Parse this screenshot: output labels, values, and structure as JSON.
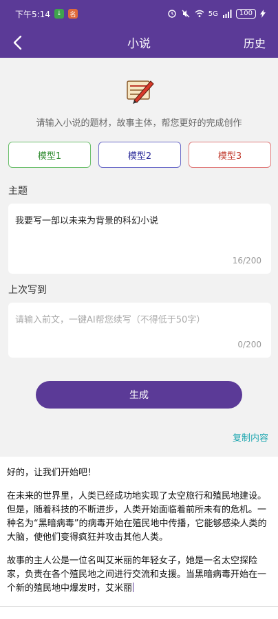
{
  "status_bar": {
    "time": "下午5:14",
    "badge_1": "↓",
    "badge_2": "名",
    "network": "5G",
    "battery": "100"
  },
  "header": {
    "title": "小说",
    "history_label": "历史"
  },
  "intro": "请输入小说的题材，故事主体，帮您更好的完成创作",
  "models": [
    {
      "label": "模型1",
      "color": "#2e8b2e"
    },
    {
      "label": "模型2",
      "color": "#2b2b9a"
    },
    {
      "label": "模型3",
      "color": "#c0392b"
    }
  ],
  "topic": {
    "label": "主题",
    "value": "我要写一部以未来为背景的科幻小说",
    "counter": "16/200"
  },
  "previous": {
    "label": "上次写到",
    "placeholder": "请输入前文，一键AI帮您续写（不得低于50字）",
    "counter": "0/200"
  },
  "generate_label": "生成",
  "copy_label": "复制内容",
  "output": {
    "paragraphs": [
      "好的，让我们开始吧！",
      "在未来的世界里，人类已经成功地实现了太空旅行和殖民地建设。但是，随着科技的不断进步，人类开始面临着前所未有的危机。一种名为“黑暗病毒”的病毒开始在殖民地中传播，它能够感染人类的大脑，使他们变得疯狂并攻击其他人类。",
      "故事的主人公是一位名叫艾米丽的年轻女子，她是一名太空探险家，负责在各个殖民地之间进行交流和支援。当黑暗病毒开始在一个新的殖民地中爆发时，艾米丽"
    ]
  },
  "colors": {
    "brand": "#5b3a97",
    "link": "#1ea7b0"
  }
}
